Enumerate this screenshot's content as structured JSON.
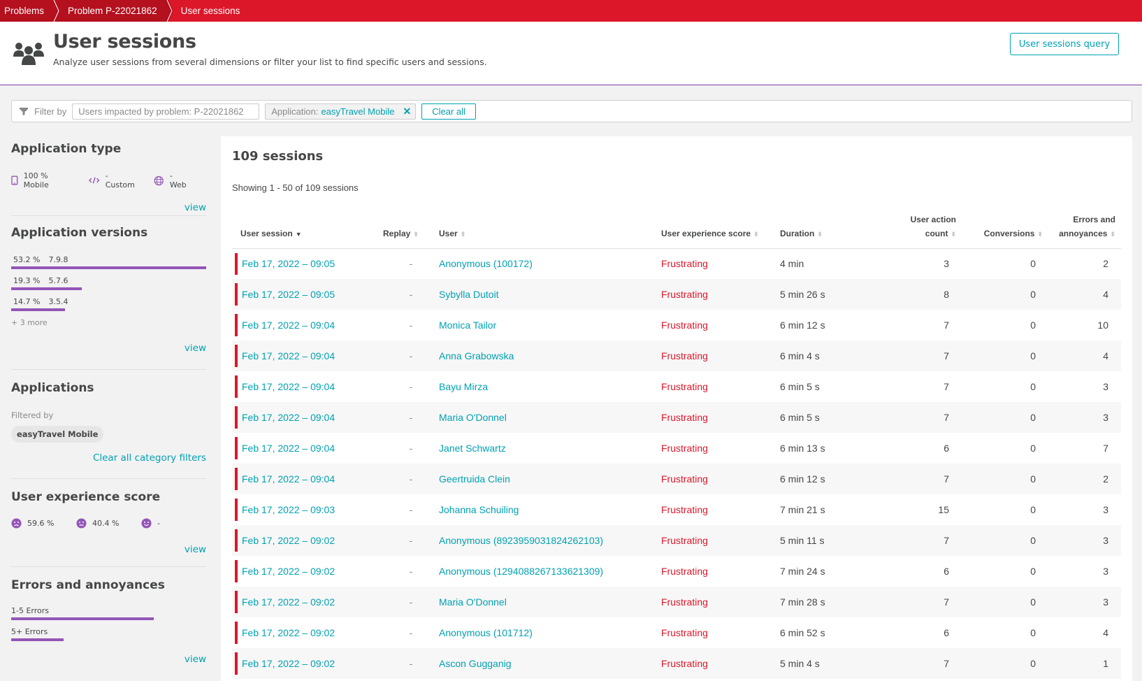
{
  "breadcrumb": [
    {
      "label": "Problems"
    },
    {
      "label": "Problem P-22021862"
    },
    {
      "label": "User sessions"
    }
  ],
  "header": {
    "title": "User sessions",
    "subtitle": "Analyze user sessions from several dimensions or filter your list to find specific users and sessions.",
    "query_button": "User sessions query"
  },
  "filter": {
    "label": "Filter by",
    "input_placeholder": "Users impacted by problem: P-22021862",
    "chip_key": "Application:",
    "chip_value": "easyTravel Mobile",
    "chip_remove": "✕",
    "clear_all": "Clear all"
  },
  "sidebar": {
    "app_type": {
      "title": "Application type",
      "items": [
        {
          "icon": "mobile-icon",
          "label": "100 % Mobile"
        },
        {
          "icon": "code-icon",
          "label": "- Custom"
        },
        {
          "icon": "globe-icon",
          "label": "- Web"
        }
      ],
      "view": "view"
    },
    "app_versions": {
      "title": "Application versions",
      "items": [
        {
          "percent": "53.2 %",
          "version": "7.9.8",
          "share": 53.2
        },
        {
          "percent": "19.3 %",
          "version": "5.7.6",
          "share": 19.3
        },
        {
          "percent": "14.7 %",
          "version": "3.5.4",
          "share": 14.7
        }
      ],
      "more": "+ 3 more",
      "view": "view"
    },
    "applications": {
      "title": "Applications",
      "filtered_by": "Filtered by",
      "chip": "easyTravel Mobile",
      "clear": "Clear all category filters"
    },
    "ux_score": {
      "title": "User experience score",
      "items": [
        {
          "icon": "frustrated-face-icon",
          "label": "59.6 %"
        },
        {
          "icon": "tolerating-face-icon",
          "label": "40.4 %"
        },
        {
          "icon": "satisfied-face-icon",
          "label": "-"
        }
      ],
      "view": "view"
    },
    "errors": {
      "title": "Errors and annoyances",
      "items": [
        {
          "label": "1-5 Errors",
          "share": 73
        },
        {
          "label": "5+ Errors",
          "share": 27
        }
      ],
      "view": "view"
    }
  },
  "main": {
    "count_title": "109 sessions",
    "showing": "Showing 1 - 50 of 109 sessions",
    "columns": {
      "session": "User session",
      "replay": "Replay",
      "user": "User",
      "ux": "User experience score",
      "duration": "Duration",
      "actions_1": "User action",
      "actions_2": "count",
      "conversions": "Conversions",
      "errors_1": "Errors and",
      "errors_2": "annoyances"
    },
    "rows": [
      {
        "date": "Feb 17, 2022  –  09:05",
        "replay": "-",
        "user": "Anonymous (100172)",
        "ux": "Frustrating",
        "duration": "4 min",
        "actions": "3",
        "conversions": "0",
        "errors": "2"
      },
      {
        "date": "Feb 17, 2022  –  09:05",
        "replay": "-",
        "user": "Sybylla Dutoit",
        "ux": "Frustrating",
        "duration": "5 min 26 s",
        "actions": "8",
        "conversions": "0",
        "errors": "4"
      },
      {
        "date": "Feb 17, 2022  –  09:04",
        "replay": "-",
        "user": "Monica Tailor",
        "ux": "Frustrating",
        "duration": "6 min 12 s",
        "actions": "7",
        "conversions": "0",
        "errors": "10"
      },
      {
        "date": "Feb 17, 2022  –  09:04",
        "replay": "-",
        "user": "Anna Grabowska",
        "ux": "Frustrating",
        "duration": "6 min 4 s",
        "actions": "7",
        "conversions": "0",
        "errors": "4"
      },
      {
        "date": "Feb 17, 2022  –  09:04",
        "replay": "-",
        "user": "Bayu Mirza",
        "ux": "Frustrating",
        "duration": "6 min 5 s",
        "actions": "7",
        "conversions": "0",
        "errors": "3"
      },
      {
        "date": "Feb 17, 2022  –  09:04",
        "replay": "-",
        "user": "Maria O'Donnel",
        "ux": "Frustrating",
        "duration": "6 min 5 s",
        "actions": "7",
        "conversions": "0",
        "errors": "3"
      },
      {
        "date": "Feb 17, 2022  –  09:04",
        "replay": "-",
        "user": "Janet Schwartz",
        "ux": "Frustrating",
        "duration": "6 min 13 s",
        "actions": "6",
        "conversions": "0",
        "errors": "7"
      },
      {
        "date": "Feb 17, 2022  –  09:04",
        "replay": "-",
        "user": "Geertruida Clein",
        "ux": "Frustrating",
        "duration": "6 min 12 s",
        "actions": "7",
        "conversions": "0",
        "errors": "2"
      },
      {
        "date": "Feb 17, 2022  –  09:03",
        "replay": "-",
        "user": "Johanna Schuiling",
        "ux": "Frustrating",
        "duration": "7 min 21 s",
        "actions": "15",
        "conversions": "0",
        "errors": "3"
      },
      {
        "date": "Feb 17, 2022  –  09:02",
        "replay": "-",
        "user": "Anonymous (8923959031824262103)",
        "ux": "Frustrating",
        "duration": "5 min 11 s",
        "actions": "7",
        "conversions": "0",
        "errors": "3"
      },
      {
        "date": "Feb 17, 2022  –  09:02",
        "replay": "-",
        "user": "Anonymous (1294088267133621309)",
        "ux": "Frustrating",
        "duration": "7 min 24 s",
        "actions": "6",
        "conversions": "0",
        "errors": "3"
      },
      {
        "date": "Feb 17, 2022  –  09:02",
        "replay": "-",
        "user": "Maria O'Donnel",
        "ux": "Frustrating",
        "duration": "7 min 28 s",
        "actions": "7",
        "conversions": "0",
        "errors": "3"
      },
      {
        "date": "Feb 17, 2022  –  09:02",
        "replay": "-",
        "user": "Anonymous (101712)",
        "ux": "Frustrating",
        "duration": "6 min 52 s",
        "actions": "6",
        "conversions": "0",
        "errors": "4"
      },
      {
        "date": "Feb 17, 2022  –  09:02",
        "replay": "-",
        "user": "Ascon Gugganig",
        "ux": "Frustrating",
        "duration": "5 min 4 s",
        "actions": "7",
        "conversions": "0",
        "errors": "1"
      }
    ]
  },
  "colors": {
    "brand_red": "#dc172a",
    "accent_teal": "#00a1b2",
    "bar_purple": "#9355b7"
  }
}
